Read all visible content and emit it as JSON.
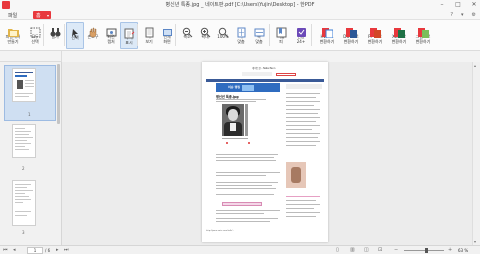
{
  "window": {
    "title": "병신년 특종.jpg _ 네이트판.pdf [C:\\Users\\Yujin\\Desktop] - 한PDF"
  },
  "menu": {
    "file": "파일",
    "home_tab": "홈",
    "right_items": [
      "?",
      "▾",
      "⚙"
    ]
  },
  "toolbar": {
    "buttons": [
      {
        "label": "파일에서\n만들기",
        "icon": "folder-open-icon"
      },
      {
        "label": "모두\n선택",
        "icon": "select-all-icon"
      },
      {
        "label": "열기",
        "icon": "binoculars-icon"
      },
      {
        "label": "선택",
        "icon": "cursor-icon"
      },
      {
        "label": "손도구",
        "icon": "hand-icon"
      },
      {
        "label": "화면\n캡처",
        "icon": "capture-icon"
      },
      {
        "label": "주석\n표시",
        "icon": "annotate-icon"
      },
      {
        "label": "쪽\n보기",
        "icon": "page-view-icon"
      },
      {
        "label": "전체\n화면",
        "icon": "fullscreen-icon"
      },
      {
        "label": "축소",
        "icon": "zoom-out-icon"
      },
      {
        "label": "확대",
        "icon": "zoom-in-icon"
      },
      {
        "label": "100%",
        "icon": "actual-size-icon"
      },
      {
        "label": "쪽\n맞춤",
        "icon": "fit-page-icon"
      },
      {
        "label": "폭\n맞춤",
        "icon": "fit-width-icon"
      },
      {
        "label": "책갈\n피",
        "icon": "bookmark-icon"
      },
      {
        "label": "변환\n24+",
        "icon": "convert-icon"
      },
      {
        "label": "HWP로\n변환하기",
        "icon": "hwp-convert-icon"
      },
      {
        "label": "DOCX로\n변환하기",
        "icon": "docx-convert-icon"
      },
      {
        "label": "PPTX로\n변환하기",
        "icon": "pptx-convert-icon"
      },
      {
        "label": "XLSX로\n변환하기",
        "icon": "xlsx-convert-icon"
      },
      {
        "label": "그림으로\n변환하기",
        "icon": "image-convert-icon"
      }
    ]
  },
  "thumbnails": {
    "pages": [
      "1",
      "2",
      "3"
    ]
  },
  "document": {
    "site_title": "네이트판 - Nate Pann",
    "banner_text": "이슈 랭킹",
    "heading": "병신년 특종.jpg",
    "footer": "http://pann.nate.com/talk/..."
  },
  "status": {
    "current_page": "1",
    "total_pages": "/ 6",
    "zoom": "63 %",
    "zoom_level": 0.55
  },
  "colors": {
    "accent": "#e8383d",
    "selection": "#dce9f7"
  }
}
